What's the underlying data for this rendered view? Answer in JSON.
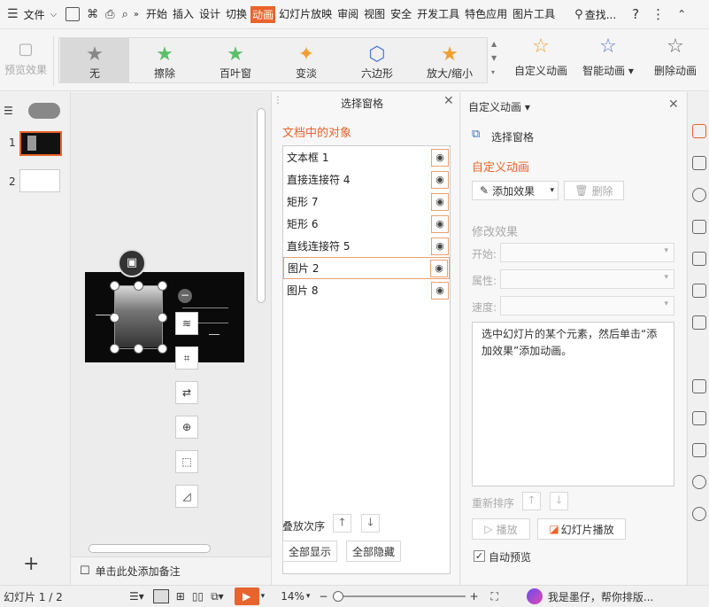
{
  "menubar": {
    "file_menu": "文件",
    "tabs": [
      "开始",
      "插入",
      "设计",
      "切换",
      "动画",
      "幻灯片放映",
      "审阅",
      "视图",
      "安全",
      "开发工具",
      "特色应用",
      "图片工具"
    ],
    "active_tab": "动画",
    "search": "查找..."
  },
  "ribbon": {
    "preview": "预览效果",
    "effects": [
      {
        "label": "无"
      },
      {
        "label": "擦除"
      },
      {
        "label": "百叶窗"
      },
      {
        "label": "变淡"
      },
      {
        "label": "六边形"
      },
      {
        "label": "放大/缩小"
      }
    ],
    "custom_animation": "自定义动画",
    "smart_animation": "智能动画",
    "delete_animation": "删除动画"
  },
  "thumbnails": [
    {
      "number": "1"
    },
    {
      "number": "2"
    }
  ],
  "slide_context_icons": [
    "layers-icon",
    "crop-icon",
    "replace-image-icon",
    "zoom-icon",
    "screenshot-icon",
    "border-icon"
  ],
  "selection_pane": {
    "title": "选择窗格",
    "section": "文档中的对象",
    "objects": [
      "文本框 1",
      "直接连接符 4",
      "矩形 7",
      "矩形 6",
      "直线连接符 5",
      "图片 2",
      "图片 8"
    ],
    "selected_object": "图片 2",
    "order_label": "叠放次序",
    "show_all": "全部显示",
    "hide_all": "全部隐藏"
  },
  "animation_pane": {
    "title": "自定义动画",
    "selection_link": "选择窗格",
    "section": "自定义动画",
    "add_effect": "添加效果",
    "delete": "删除",
    "modify_section": "修改效果",
    "start_label": "开始:",
    "property_label": "属性:",
    "speed_label": "速度:",
    "hint": "选中幻灯片的某个元素，然后单击“添加效果”添加动画。",
    "reorder": "重新排序",
    "play": "播放",
    "slideshow": "幻灯片播放",
    "auto_preview": "自动预览"
  },
  "notes": {
    "placeholder": "单击此处添加备注"
  },
  "statusbar": {
    "slide_info": "幻灯片 1 / 2",
    "zoom": "14%",
    "assistant": "我是墨仔，帮你排版..."
  },
  "colors": {
    "accent": "#e8642c",
    "star_green": "#5bbf6a",
    "star_orange": "#f0a030"
  }
}
